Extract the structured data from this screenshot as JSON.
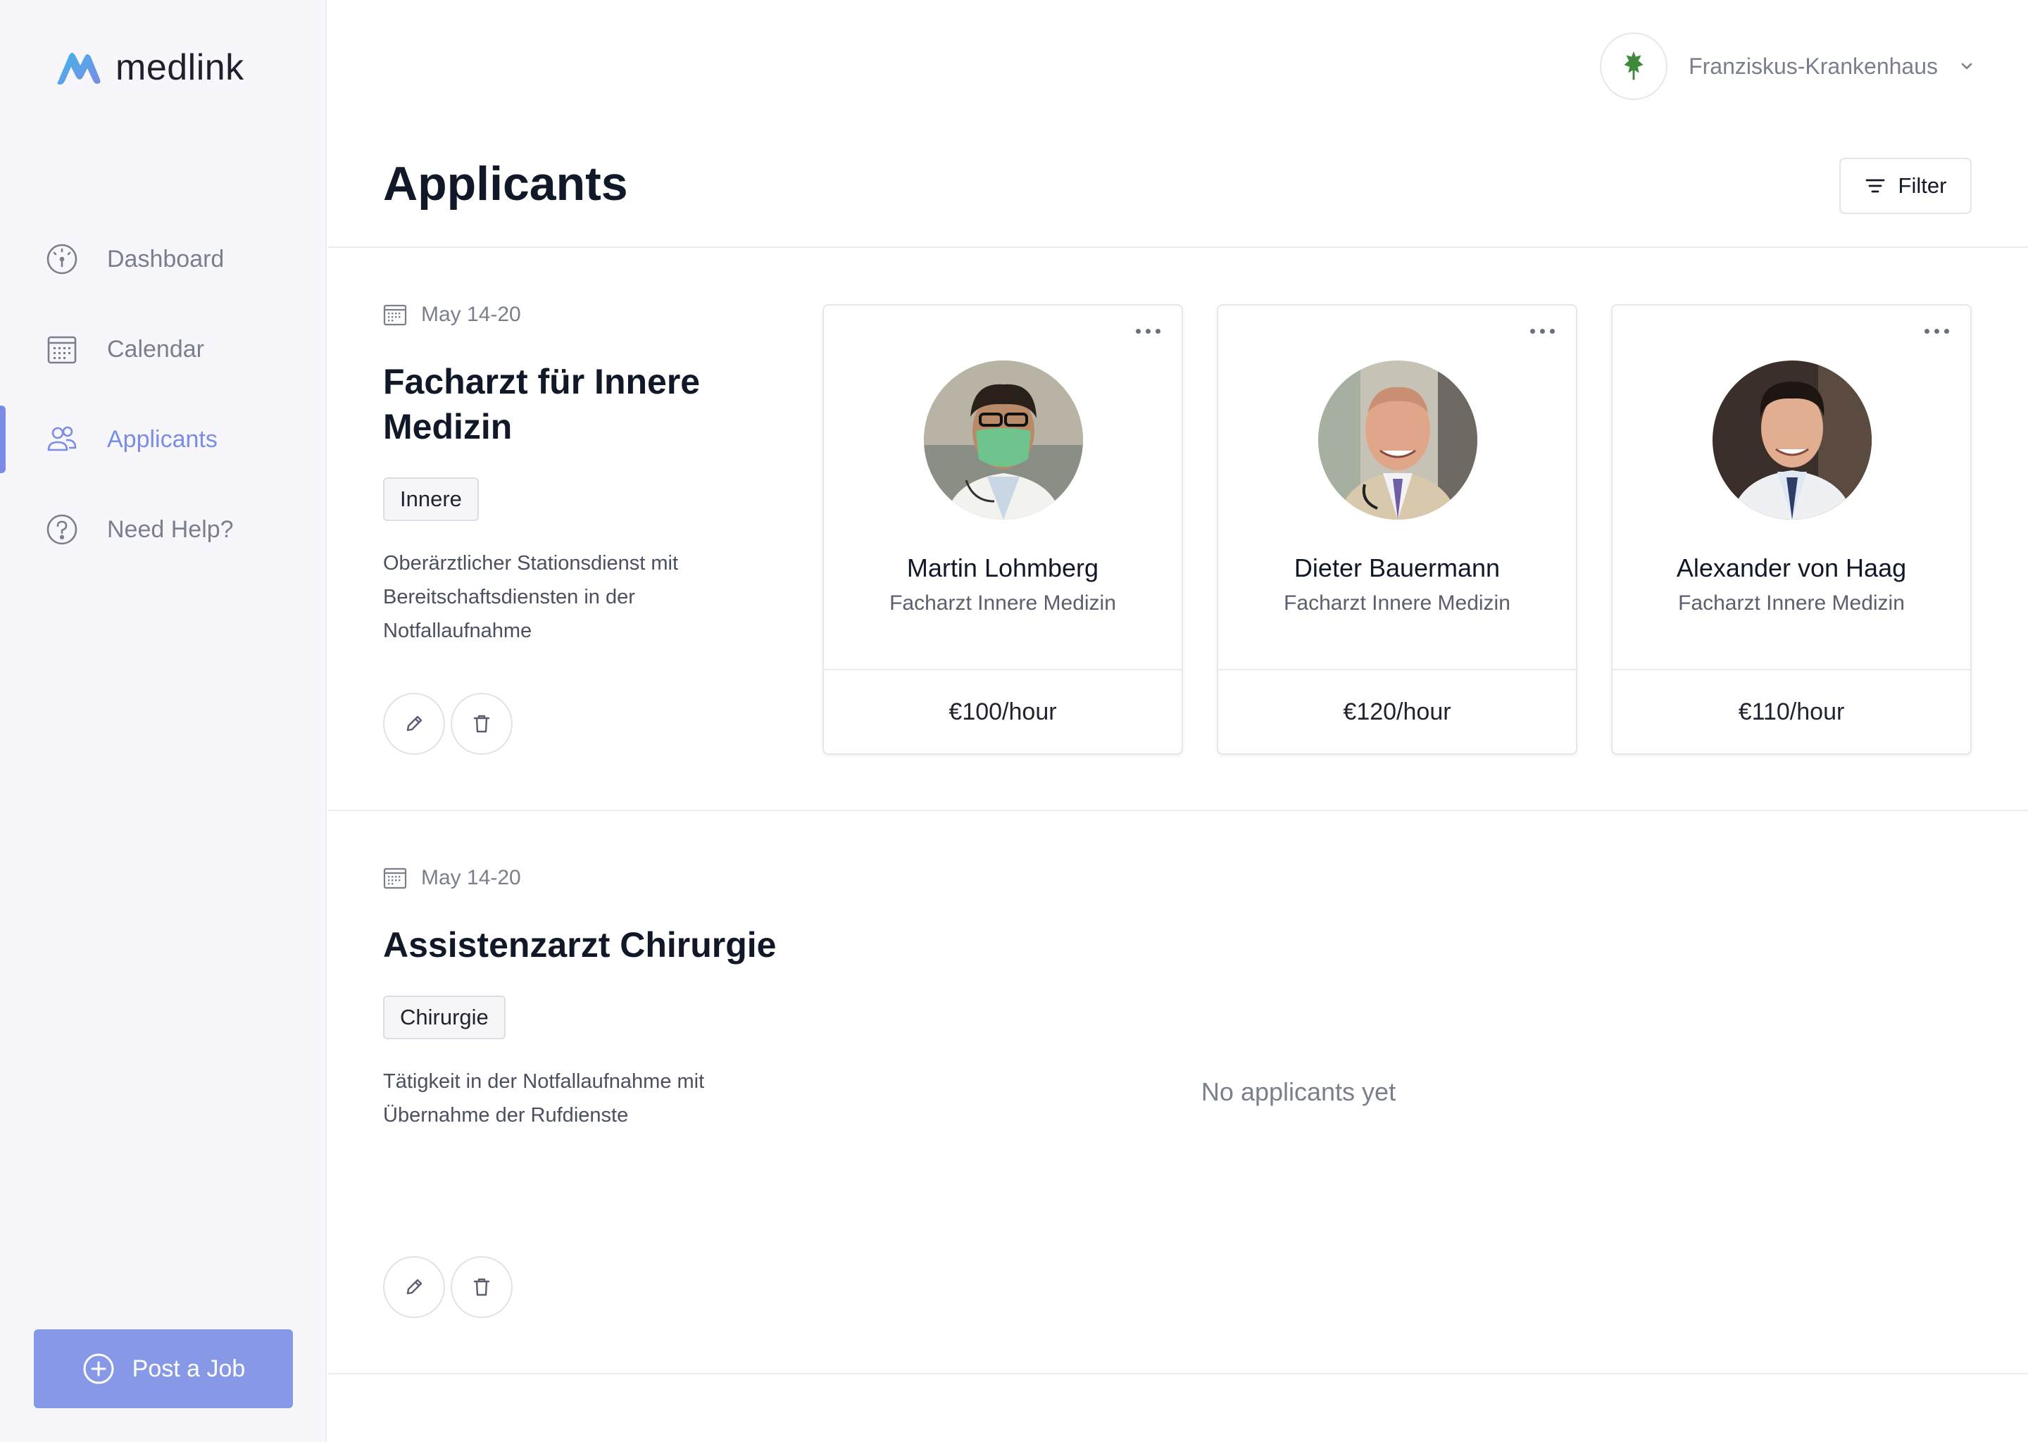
{
  "brand": {
    "name": "medlink"
  },
  "sidebar": {
    "items": [
      {
        "label": "Dashboard",
        "icon": "dashboard-gauge-icon",
        "active": false
      },
      {
        "label": "Calendar",
        "icon": "calendar-icon",
        "active": false
      },
      {
        "label": "Applicants",
        "icon": "users-icon",
        "active": true
      },
      {
        "label": "Need Help?",
        "icon": "help-circle-icon",
        "active": false
      }
    ],
    "post_job_label": "Post a Job"
  },
  "header": {
    "org_name": "Franziskus-Krankenhaus",
    "page_title": "Applicants",
    "filter_label": "Filter"
  },
  "jobs": [
    {
      "date": "May 14-20",
      "title": "Facharzt für Innere Medizin",
      "tag": "Innere",
      "description": "Oberärztlicher Stationsdienst mit Bereitschaftsdiensten in der Notfallaufnahme",
      "applicants": [
        {
          "name": "Martin Lohmberg",
          "role": "Facharzt Innere Medizin",
          "rate": "€100/hour"
        },
        {
          "name": "Dieter Bauermann",
          "role": "Facharzt Innere Medizin",
          "rate": "€120/hour"
        },
        {
          "name": "Alexander von Haag",
          "role": "Facharzt Innere Medizin",
          "rate": "€110/hour"
        }
      ]
    },
    {
      "date": "May 14-20",
      "title": "Assistenzarzt Chirurgie",
      "tag": "Chirurgie",
      "description": "Tätigkeit in der Notfallaufnahme mit Übernahme der Rufdienste",
      "applicants": [],
      "empty_label": "No applicants yet"
    }
  ],
  "colors": {
    "accent": "#7b8ce6",
    "post_button": "#8799e6",
    "sidebar_bg": "#f7f7fb",
    "muted_text": "#7a7f8e"
  }
}
